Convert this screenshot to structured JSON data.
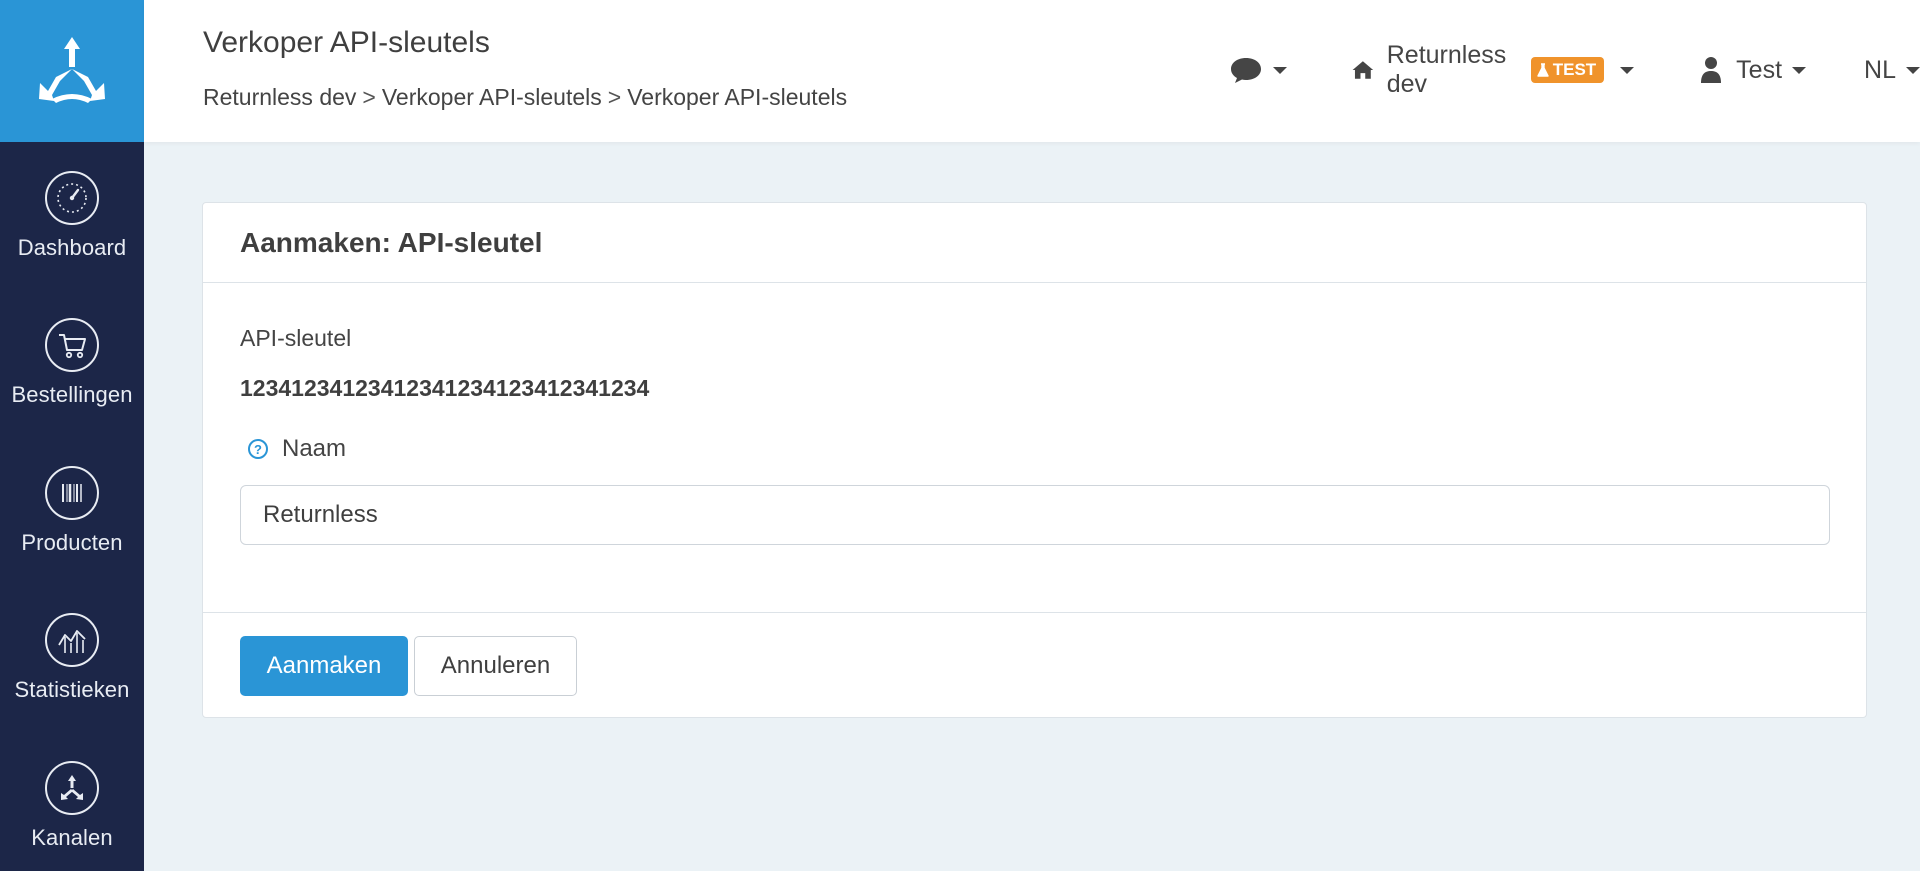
{
  "header": {
    "title": "Verkoper API-sleutels",
    "breadcrumb": [
      "Returnless dev",
      "Verkoper API-sleutels",
      "Verkoper API-sleutels"
    ],
    "breadcrumb_separator": ">",
    "org_name": "Returnless dev",
    "env_badge": "TEST",
    "user_name": "Test",
    "language": "NL"
  },
  "sidebar": {
    "items": [
      {
        "label": "Dashboard",
        "icon": "speedometer-icon"
      },
      {
        "label": "Bestellingen",
        "icon": "cart-icon"
      },
      {
        "label": "Producten",
        "icon": "barcode-icon"
      },
      {
        "label": "Statistieken",
        "icon": "chart-icon"
      },
      {
        "label": "Kanalen",
        "icon": "channels-icon"
      }
    ]
  },
  "card": {
    "title": "Aanmaken: API-sleutel",
    "api_key_label": "API-sleutel",
    "api_key_value": "12341234123412341234123412341234",
    "name_label": "Naam",
    "name_value": "Returnless",
    "create_button": "Aanmaken",
    "cancel_button": "Annuleren"
  },
  "colors": {
    "sidebar_bg": "#1c2648",
    "brand_blue": "#2a95d6",
    "badge_orange": "#f0932b",
    "page_bg": "#ebf2f6"
  }
}
